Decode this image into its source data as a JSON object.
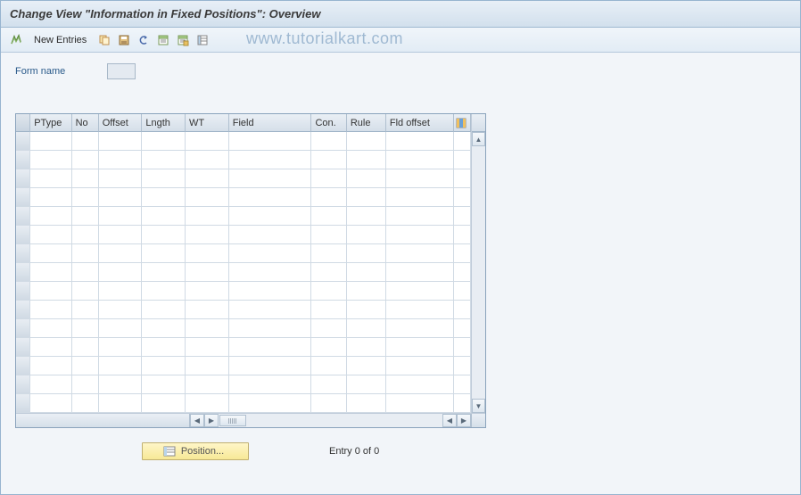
{
  "title": "Change View \"Information in Fixed Positions\": Overview",
  "toolbar": {
    "new_entries_label": "New Entries"
  },
  "watermark": "www.tutorialkart.com",
  "form": {
    "name_label": "Form name",
    "name_value": ""
  },
  "table": {
    "columns": {
      "ptype": "PType",
      "no": "No",
      "offset": "Offset",
      "lngth": "Lngth",
      "wt": "WT",
      "field": "Field",
      "con": "Con.",
      "rule": "Rule",
      "fldoffset": "Fld offset"
    },
    "row_count": 15
  },
  "footer": {
    "position_label": "Position...",
    "entry_status": "Entry 0 of 0"
  }
}
